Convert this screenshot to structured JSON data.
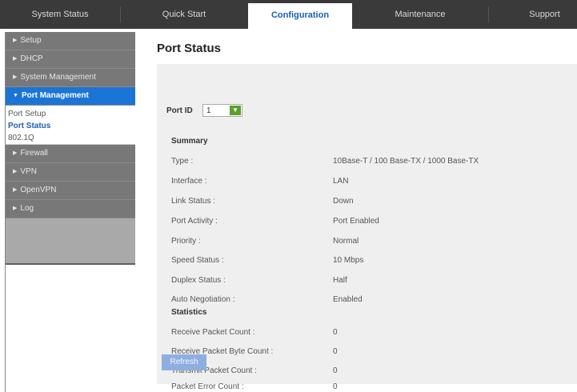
{
  "nav": {
    "tabs": [
      {
        "label": "System Status"
      },
      {
        "label": "Quick Start"
      },
      {
        "label": "Configuration"
      },
      {
        "label": "Maintenance"
      },
      {
        "label": "Support"
      }
    ]
  },
  "sidebar": {
    "items": [
      {
        "label": "Setup"
      },
      {
        "label": "DHCP"
      },
      {
        "label": "System Management"
      },
      {
        "label": "Port Management"
      },
      {
        "label": "Firewall"
      },
      {
        "label": "VPN"
      },
      {
        "label": "OpenVPN"
      },
      {
        "label": "Log"
      }
    ],
    "subitems": [
      {
        "label": "Port Setup"
      },
      {
        "label": "Port Status"
      },
      {
        "label": "802.1Q"
      }
    ]
  },
  "page": {
    "title": "Port Status",
    "port_id_label": "Port ID",
    "port_id_value": "1",
    "summary_heading": "Summary",
    "summary": [
      {
        "label": "Type :",
        "value": "10Base-T / 100 Base-TX / 1000 Base-TX"
      },
      {
        "label": "Interface :",
        "value": "LAN"
      },
      {
        "label": "Link Status :",
        "value": "Down"
      },
      {
        "label": "Port Activity :",
        "value": "Port Enabled"
      },
      {
        "label": "Priority :",
        "value": "Normal"
      },
      {
        "label": "Speed Status :",
        "value": "10 Mbps"
      },
      {
        "label": "Duplex Status :",
        "value": "Half"
      },
      {
        "label": "Auto Negotiation :",
        "value": "Enabled"
      }
    ],
    "statistics_heading": "Statistics",
    "statistics": [
      {
        "label": "Receive Packet Count :",
        "value": "0"
      },
      {
        "label": "Receive Packet Byte Count :",
        "value": "0"
      },
      {
        "label": "Transmit Packet Count :",
        "value": "0"
      },
      {
        "label": "Packet Error Count :",
        "value": "0"
      }
    ],
    "refresh_label": "Refresh"
  },
  "colors": {
    "accent": "#1b75d4",
    "nav_bg": "#3a3a3a",
    "sidebar_bg": "#787878",
    "panel_bg": "#efefef",
    "select_button": "#5aa02c"
  }
}
